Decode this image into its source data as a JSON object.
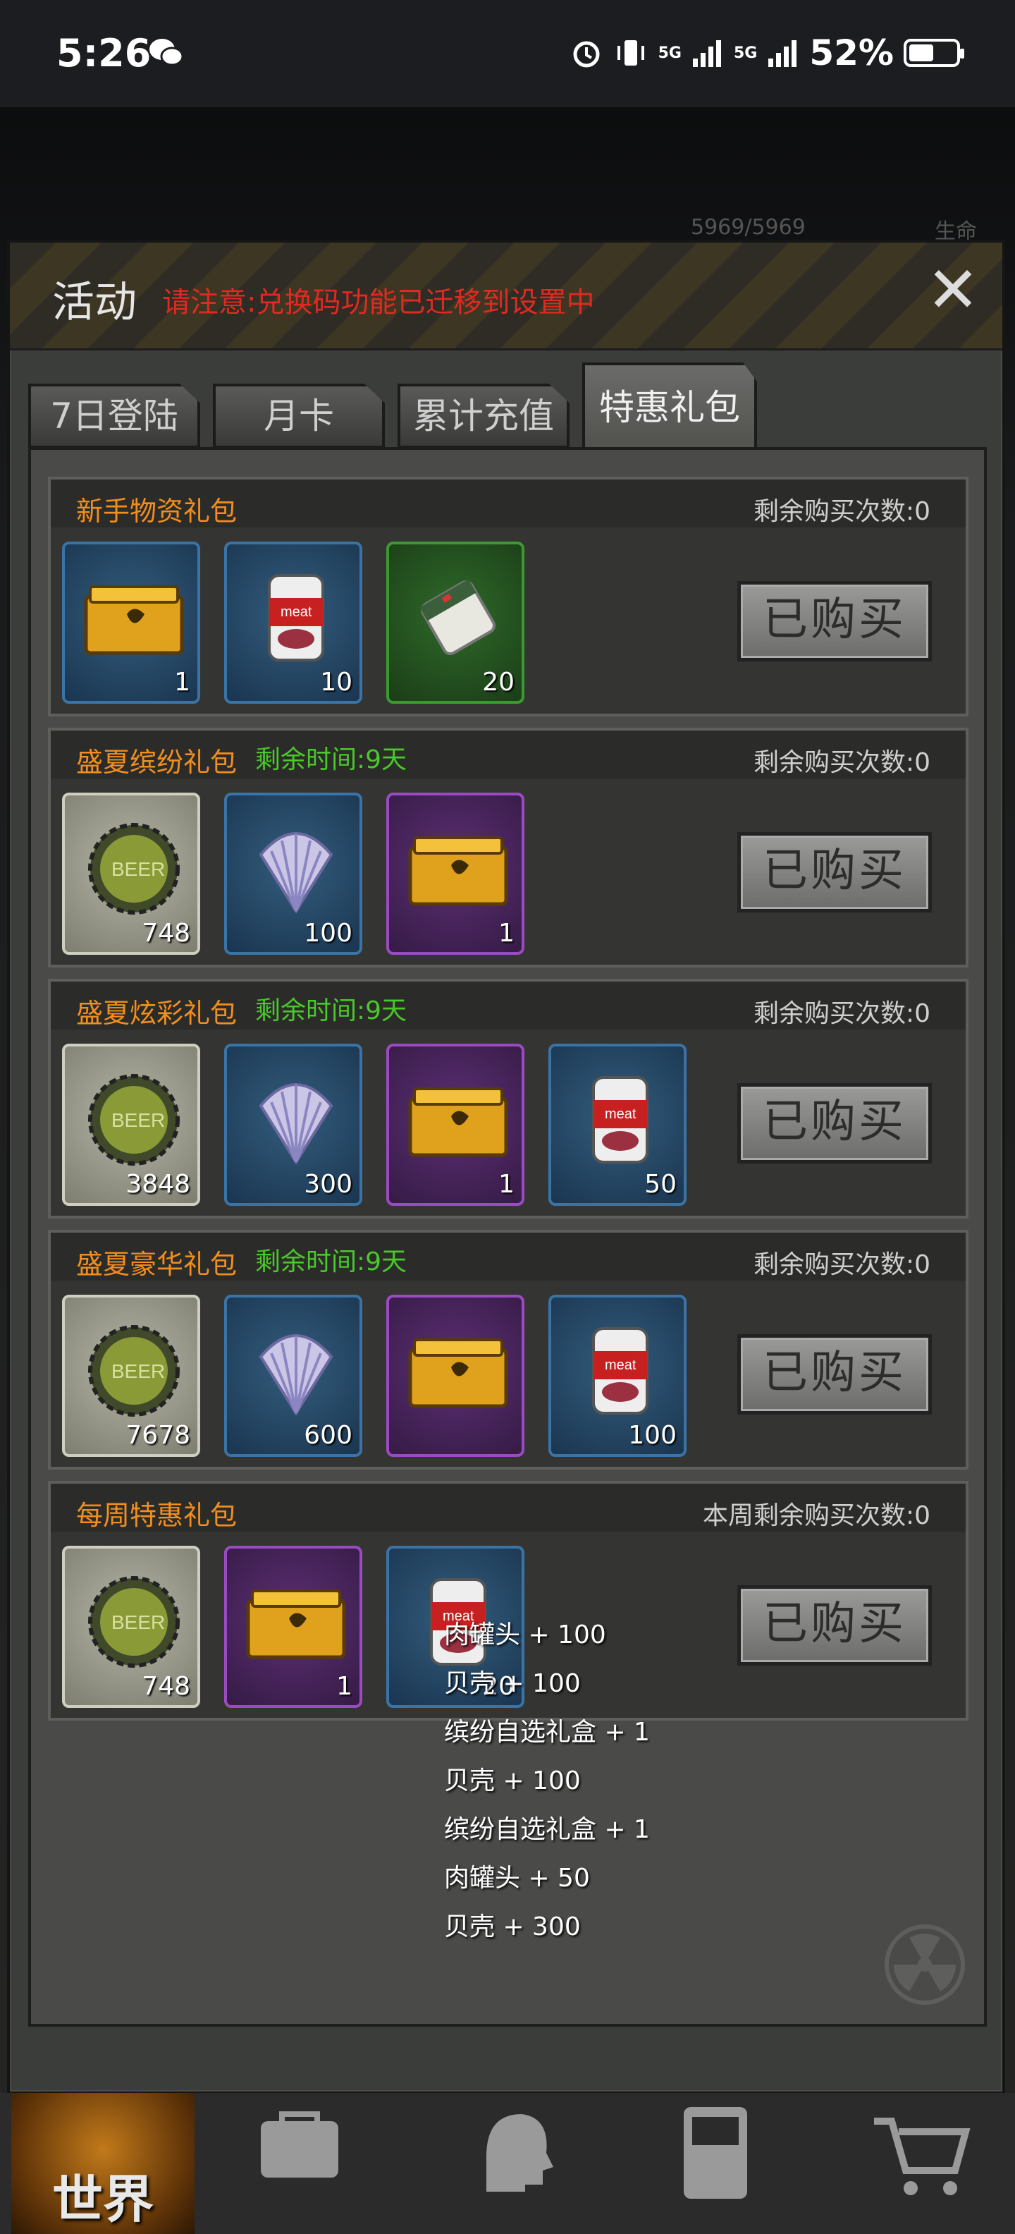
{
  "status_bar": {
    "time": "5:26",
    "battery": "52%",
    "network_1": "5G",
    "network_2": "5G",
    "icons": [
      "wechat-icon",
      "alarm-icon",
      "vibrate-icon",
      "signal-icon",
      "battery-icon"
    ]
  },
  "hud": {
    "hp": "5969/5969",
    "hp_label": "生命"
  },
  "panel": {
    "title": "活动",
    "notice": "请注意:兑换码功能已迁移到设置中",
    "close_icon": "close-icon"
  },
  "tabs": [
    {
      "label": "7日登陆"
    },
    {
      "label": "月卡"
    },
    {
      "label": "累计充值"
    },
    {
      "label": "特惠礼包",
      "active": true
    }
  ],
  "packs": [
    {
      "name": "新手物资礼包",
      "time": "",
      "remain": "剩余购买次数:0",
      "button": "已购买",
      "items": [
        {
          "icon": "gold-crate-icon",
          "rarity": "blue",
          "qty": "1"
        },
        {
          "icon": "meat-can-icon",
          "rarity": "blue",
          "qty": "10"
        },
        {
          "icon": "bandage-icon",
          "rarity": "green",
          "qty": "20"
        }
      ]
    },
    {
      "name": "盛夏缤纷礼包",
      "time": "剩余时间:9天",
      "remain": "剩余购买次数:0",
      "button": "已购买",
      "items": [
        {
          "icon": "bottle-cap-icon",
          "rarity": "grey",
          "qty": "748"
        },
        {
          "icon": "shell-icon",
          "rarity": "blue",
          "qty": "100"
        },
        {
          "icon": "gold-crate-icon",
          "rarity": "purple",
          "qty": "1"
        }
      ]
    },
    {
      "name": "盛夏炫彩礼包",
      "time": "剩余时间:9天",
      "remain": "剩余购买次数:0",
      "button": "已购买",
      "items": [
        {
          "icon": "bottle-cap-icon",
          "rarity": "grey",
          "qty": "3848"
        },
        {
          "icon": "shell-icon",
          "rarity": "blue",
          "qty": "300"
        },
        {
          "icon": "gold-crate-icon",
          "rarity": "purple",
          "qty": "1"
        },
        {
          "icon": "meat-can-icon",
          "rarity": "blue",
          "qty": "50"
        }
      ]
    },
    {
      "name": "盛夏豪华礼包",
      "time": "剩余时间:9天",
      "remain": "剩余购买次数:0",
      "button": "已购买",
      "items": [
        {
          "icon": "bottle-cap-icon",
          "rarity": "grey",
          "qty": "7678"
        },
        {
          "icon": "shell-icon",
          "rarity": "blue",
          "qty": "600"
        },
        {
          "icon": "gold-crate-icon",
          "rarity": "purple",
          "qty": ""
        },
        {
          "icon": "meat-can-icon",
          "rarity": "blue",
          "qty": "100"
        }
      ]
    },
    {
      "name": "每周特惠礼包",
      "time": "",
      "remain": "本周剩余购买次数:0",
      "button": "已购买",
      "items": [
        {
          "icon": "bottle-cap-icon",
          "rarity": "grey",
          "qty": "748"
        },
        {
          "icon": "gold-crate-icon",
          "rarity": "purple",
          "qty": "1"
        },
        {
          "icon": "meat-can-icon",
          "rarity": "blue",
          "qty": "20"
        }
      ]
    }
  ],
  "tooltip_lines": [
    "肉罐头 + 100",
    "贝壳 + 100",
    "缤纷自选礼盒 + 1",
    "贝壳 + 100",
    "缤纷自选礼盒 + 1",
    "肉罐头 + 50",
    "贝壳 + 300"
  ],
  "bottom_nav": {
    "world_label": "世界",
    "icons": [
      "backpack-icon",
      "skills-head-icon",
      "phone-icon",
      "cart-icon"
    ]
  },
  "colors": {
    "pack_name": "#f28e1e",
    "time_green": "#49c92a",
    "notice_red": "#e02a21"
  }
}
